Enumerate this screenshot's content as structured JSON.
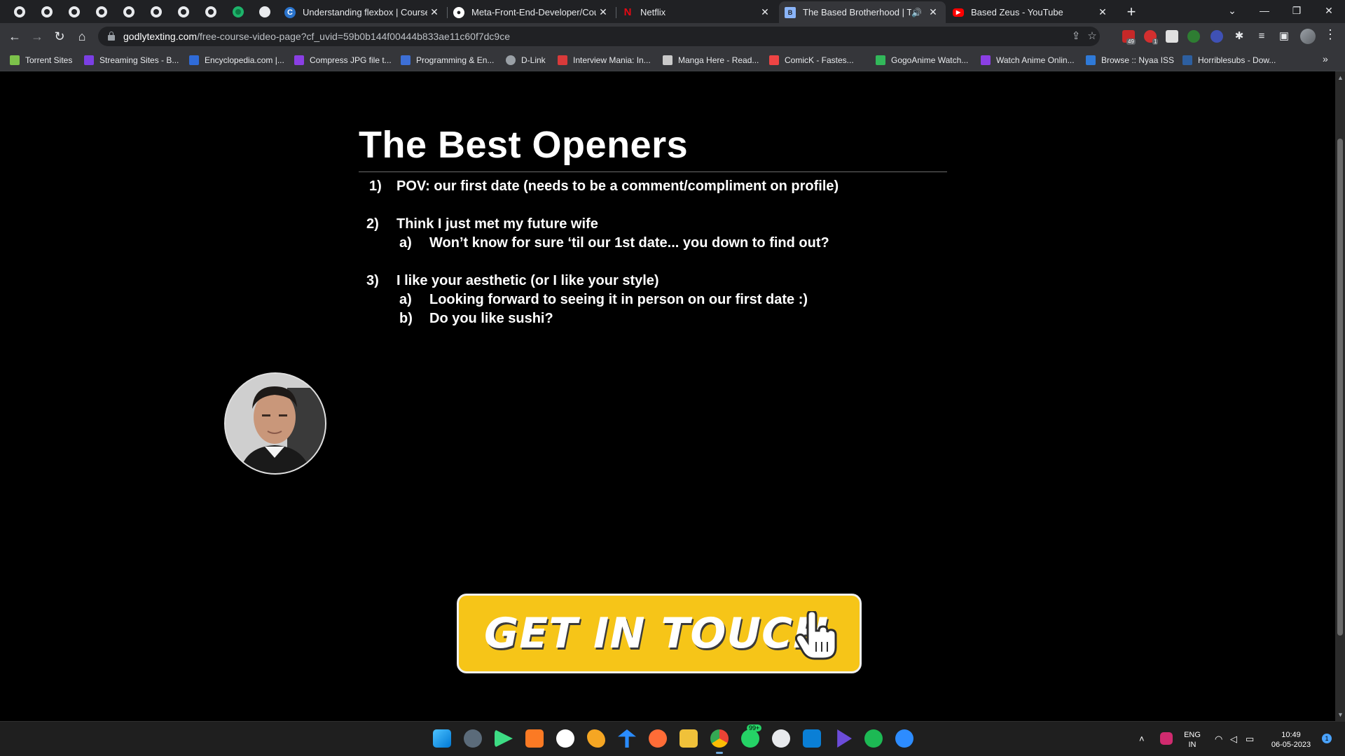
{
  "browser": {
    "tabs": [
      {
        "title": "Understanding flexbox | Coursera",
        "favicon": "coursera-icon",
        "color": "#2a73cc"
      },
      {
        "title": "Meta-Front-End-Developer/Cou",
        "favicon": "github-icon",
        "color": "#ffffff"
      },
      {
        "title": "Netflix",
        "favicon": "netflix-icon",
        "color": "#e50914"
      },
      {
        "title": "The Based Brotherhood | The",
        "favicon": "site-icon",
        "color": "#8ab4f8",
        "active": true
      },
      {
        "title": "Based Zeus - YouTube",
        "favicon": "youtube-icon",
        "color": "#ff0000"
      }
    ],
    "address": {
      "host": "godlytexting.com",
      "path": "/free-course-video-page?cf_uvid=59b0b144f00444b833ae11c60f7dc9ce"
    },
    "bookmarks": [
      {
        "label": "Torrent Sites",
        "color": "#7cc24a"
      },
      {
        "label": "Streaming Sites - B...",
        "color": "#7b3fe4"
      },
      {
        "label": "Encyclopedia.com |...",
        "color": "#2f6bd8"
      },
      {
        "label": "Compress JPG file t...",
        "color": "#8a3fe4"
      },
      {
        "label": "Programming & En...",
        "color": "#3d6fd6"
      },
      {
        "label": "D-Link",
        "color": "#9aa0a6"
      },
      {
        "label": "Interview Mania: In...",
        "color": "#d93a3a"
      },
      {
        "label": "Manga Here - Read...",
        "color": "#c9c9c9"
      },
      {
        "label": "ComicK - Fastes...",
        "color": "#e44"
      },
      {
        "label": "GogoAnime Watch...",
        "color": "#32b85a"
      },
      {
        "label": "Watch Anime Onlin...",
        "color": "#8b3fe4"
      },
      {
        "label": "Browse :: Nyaa ISS",
        "color": "#2f7ad8"
      },
      {
        "label": "Horriblesubs - Dow...",
        "color": "#2d5fa0"
      }
    ],
    "extension_badges": {
      "first": "49",
      "second": "1"
    }
  },
  "slide": {
    "title": "The Best Openers",
    "items": [
      {
        "num": "1)",
        "text": "POV: our first date (needs to be a comment/compliment on profile)"
      },
      {
        "num": "2)",
        "text": "Think I just met my future wife"
      },
      {
        "num": "a)",
        "text": "Won’t know for sure ‘til our 1st date... you down to find out?"
      },
      {
        "num": "3)",
        "text": "I like your aesthetic (or I like your style)"
      },
      {
        "num": "a)",
        "text": "Looking forward to seeing it in person on our first date :)"
      },
      {
        "num": "b)",
        "text": "Do you like sushi?"
      }
    ],
    "cta_label": "GET IN TOUCH",
    "cta_color": "#f6c518"
  },
  "taskbar": {
    "language_top": "ENG",
    "language_bottom": "IN",
    "time": "10:49",
    "date": "06-05-2023",
    "whatsapp_badge": "99+",
    "notification_count": "1"
  }
}
